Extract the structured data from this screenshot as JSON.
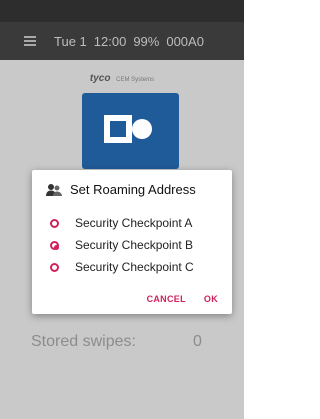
{
  "status_bar": {
    "date": "Tue 1",
    "time": "12:00",
    "battery": "99%",
    "code": "000A0"
  },
  "branding": {
    "logo_text": "tyco",
    "company": "CEM Systems"
  },
  "main": {
    "stored_label": "Stored swipes:",
    "stored_value": "0"
  },
  "dialog": {
    "title": "Set Roaming Address",
    "options": [
      {
        "label": "Security Checkpoint A",
        "selected": false
      },
      {
        "label": "Security Checkpoint B",
        "selected": true
      },
      {
        "label": "Security Checkpoint C",
        "selected": false
      }
    ],
    "cancel_label": "CANCEL",
    "ok_label": "OK"
  },
  "colors": {
    "accent": "#d0225a",
    "app_tile": "#1f5b99"
  }
}
